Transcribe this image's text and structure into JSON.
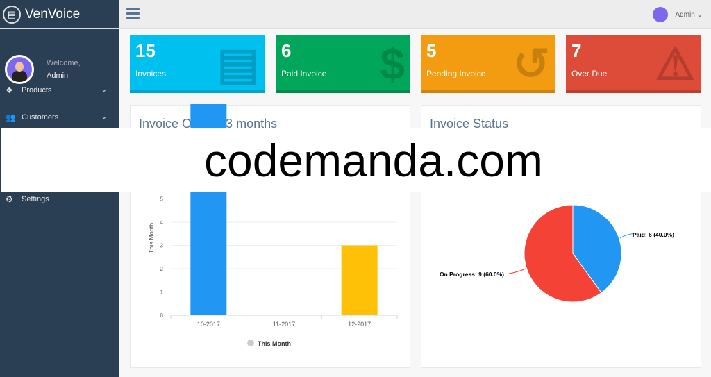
{
  "brand": {
    "name": "VenVoice"
  },
  "profile": {
    "welcome": "Welcome,",
    "name": "Admin"
  },
  "nav": [
    {
      "label": "Products",
      "icon": "cubes-icon"
    },
    {
      "label": "Customers",
      "icon": "users-icon"
    },
    {
      "label": "Settings",
      "icon": "cogs-icon"
    }
  ],
  "topbar": {
    "user": "Admin"
  },
  "tiles": [
    {
      "value": "15",
      "label": "Invoices",
      "color": "#00c0ef",
      "icon": "file-icon"
    },
    {
      "value": "6",
      "label": "Paid Invoice",
      "color": "#00a65a",
      "icon": "dollar-icon"
    },
    {
      "value": "5",
      "label": "Pending Invoice",
      "color": "#f39c12",
      "icon": "history-icon"
    },
    {
      "value": "7",
      "label": "Over Due",
      "color": "#dd4b39",
      "icon": "warning-icon"
    }
  ],
  "panels": {
    "left_title": "Invoice Of Last 3 months",
    "right_title": "Invoice Status"
  },
  "watermark": "codemanda.com",
  "chart_data": [
    {
      "type": "bar",
      "categories": [
        "10-2017",
        "11-2017",
        "12-2017"
      ],
      "values": [
        null,
        0,
        3
      ],
      "colors": [
        "#2196f3",
        "#4caf50",
        "#ffc107"
      ],
      "ylabel": "This Month",
      "legend": "This Month",
      "yticks": [
        0,
        1,
        2,
        3,
        4,
        5
      ],
      "grid": true,
      "legend_position": "bottom"
    },
    {
      "type": "pie",
      "slices": [
        {
          "label": "Paid: 6 (40.0%)",
          "name": "Paid",
          "value": 6,
          "percent": 40.0,
          "color": "#2196f3"
        },
        {
          "label": "On Progress: 9 (60.0%)",
          "name": "On Progress",
          "value": 9,
          "percent": 60.0,
          "color": "#f44336"
        }
      ]
    }
  ]
}
